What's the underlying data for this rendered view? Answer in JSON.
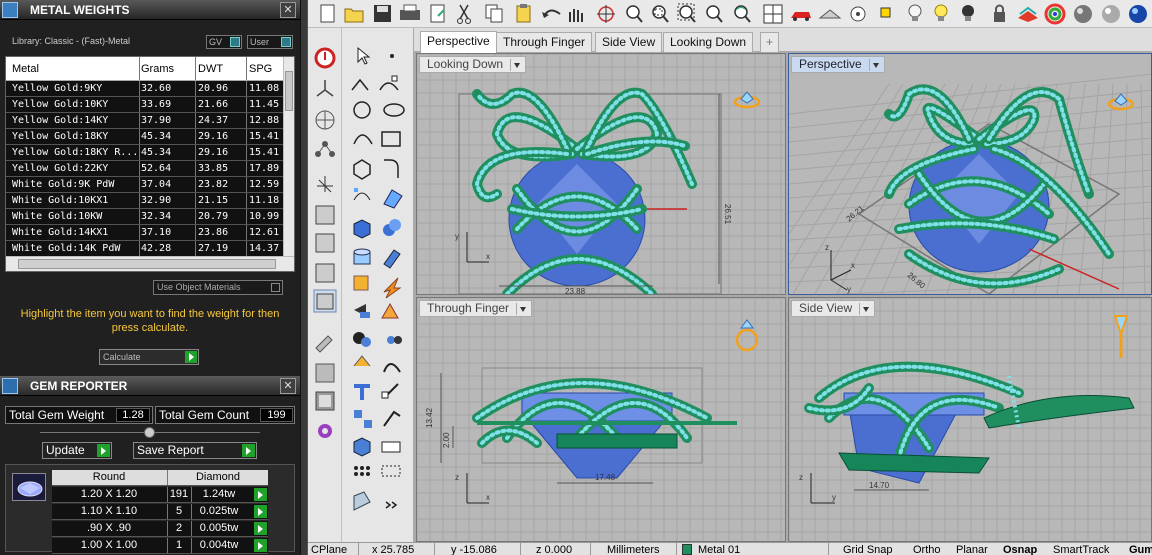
{
  "metal_weights": {
    "title": "METAL WEIGHTS",
    "close": "✕",
    "library": "Library: Classic - (Fast)-Metal",
    "toggle_gv": "GV",
    "toggle_user": "User",
    "columns": [
      "Metal",
      "Grams",
      "DWT",
      "SPG"
    ],
    "rows": [
      [
        "Yellow Gold:9KY",
        "32.60",
        "20.96",
        "11.08"
      ],
      [
        "Yellow Gold:10KY",
        "33.69",
        "21.66",
        "11.45"
      ],
      [
        "Yellow Gold:14KY",
        "37.90",
        "24.37",
        "12.88"
      ],
      [
        "Yellow Gold:18KY",
        "45.34",
        "29.16",
        "15.41"
      ],
      [
        "Yellow Gold:18KY R...",
        "45.34",
        "29.16",
        "15.41"
      ],
      [
        "Yellow Gold:22KY",
        "52.64",
        "33.85",
        "17.89"
      ],
      [
        "White Gold:9K PdW",
        "37.04",
        "23.82",
        "12.59"
      ],
      [
        "White Gold:10KX1",
        "32.90",
        "21.15",
        "11.18"
      ],
      [
        "White Gold:10KW",
        "32.34",
        "20.79",
        "10.99"
      ],
      [
        "White Gold:14KX1",
        "37.10",
        "23.86",
        "12.61"
      ],
      [
        "White Gold:14K PdW",
        "42.28",
        "27.19",
        "14.37"
      ]
    ],
    "use_object_materials": "Use Object Materials",
    "hint": "Highlight the item you want to find the weight for then press calculate.",
    "calculate": "Calculate"
  },
  "gem_reporter": {
    "title": "GEM REPORTER",
    "close": "✕",
    "total_weight_label": "Total Gem Weight",
    "total_weight": "1.28",
    "total_count_label": "Total Gem Count",
    "total_count": "199",
    "update": "Update",
    "save_report": "Save Report",
    "columns": [
      "Round",
      "Diamond"
    ],
    "rows": [
      [
        "1.20 X 1.20",
        "191",
        "1.24tw"
      ],
      [
        "1.10 X 1.10",
        "5",
        "0.025tw"
      ],
      [
        ".90 X .90",
        "2",
        "0.005tw"
      ],
      [
        "1.00 X 1.00",
        "1",
        "0.004tw"
      ]
    ]
  },
  "tabs": [
    "Perspective",
    "Through Finger",
    "Side View",
    "Looking Down",
    "+"
  ],
  "viewports": {
    "looking_down": {
      "title": "Looking Down",
      "dim_w": "23.88",
      "dim_h": "26.51"
    },
    "perspective": {
      "title": "Perspective",
      "dim_a": "26.80",
      "dim_b": "26.21"
    },
    "through_finger": {
      "title": "Through Finger",
      "dim_w": "17.48",
      "dim_h1": "13.42",
      "dim_h2": "2.00"
    },
    "side_view": {
      "title": "Side View",
      "dim_w": "14.70"
    },
    "axis_x": "x",
    "axis_y": "y",
    "axis_z": "z"
  },
  "status": {
    "cplane": "CPlane",
    "x": "x 25.785",
    "y": "y -15.086",
    "z": "z 0.000",
    "units": "Millimeters",
    "layer": "Metal 01",
    "grid_snap": "Grid Snap",
    "ortho": "Ortho",
    "planar": "Planar",
    "osnap": "Osnap",
    "smarttrack": "SmartTrack",
    "gumball": "Gum"
  },
  "colors": {
    "gem_blue": "#4a6fd0",
    "metal_green": "#1f8f5f",
    "prong_cyan": "#7fe0e8",
    "accent_green": "#1fa12a"
  }
}
